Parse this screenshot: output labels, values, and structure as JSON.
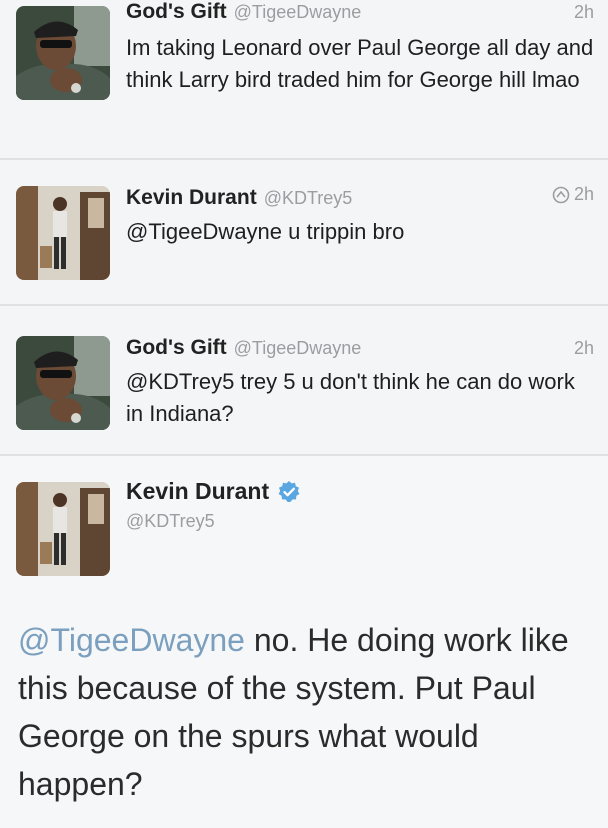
{
  "tweets": [
    {
      "name": "God's Gift",
      "handle": "@TigeeDwayne",
      "time": "2h",
      "text": "Im taking Leonard over Paul George all day and think Larry bird traded him for George hill lmao"
    },
    {
      "name": "Kevin Durant",
      "handle": "@KDTrey5",
      "time": "2h",
      "text": "@TigeeDwayne u trippin bro"
    },
    {
      "name": "God's Gift",
      "handle": "@TigeeDwayne",
      "time": "2h",
      "text": "@KDTrey5 trey 5 u don't think he can do work in Indiana?"
    }
  ],
  "featured": {
    "name": "Kevin Durant",
    "handle": "@KDTrey5",
    "mention": "@TigeeDwayne",
    "text": " no. He doing work like this because of the system. Put Paul George on the spurs what would happen?"
  },
  "colors": {
    "mention": "#7b9fbe",
    "verified": "#5aa6e0",
    "muted": "#9a9ea2"
  },
  "icons": [
    "conversation-icon",
    "verified-badge-icon"
  ]
}
